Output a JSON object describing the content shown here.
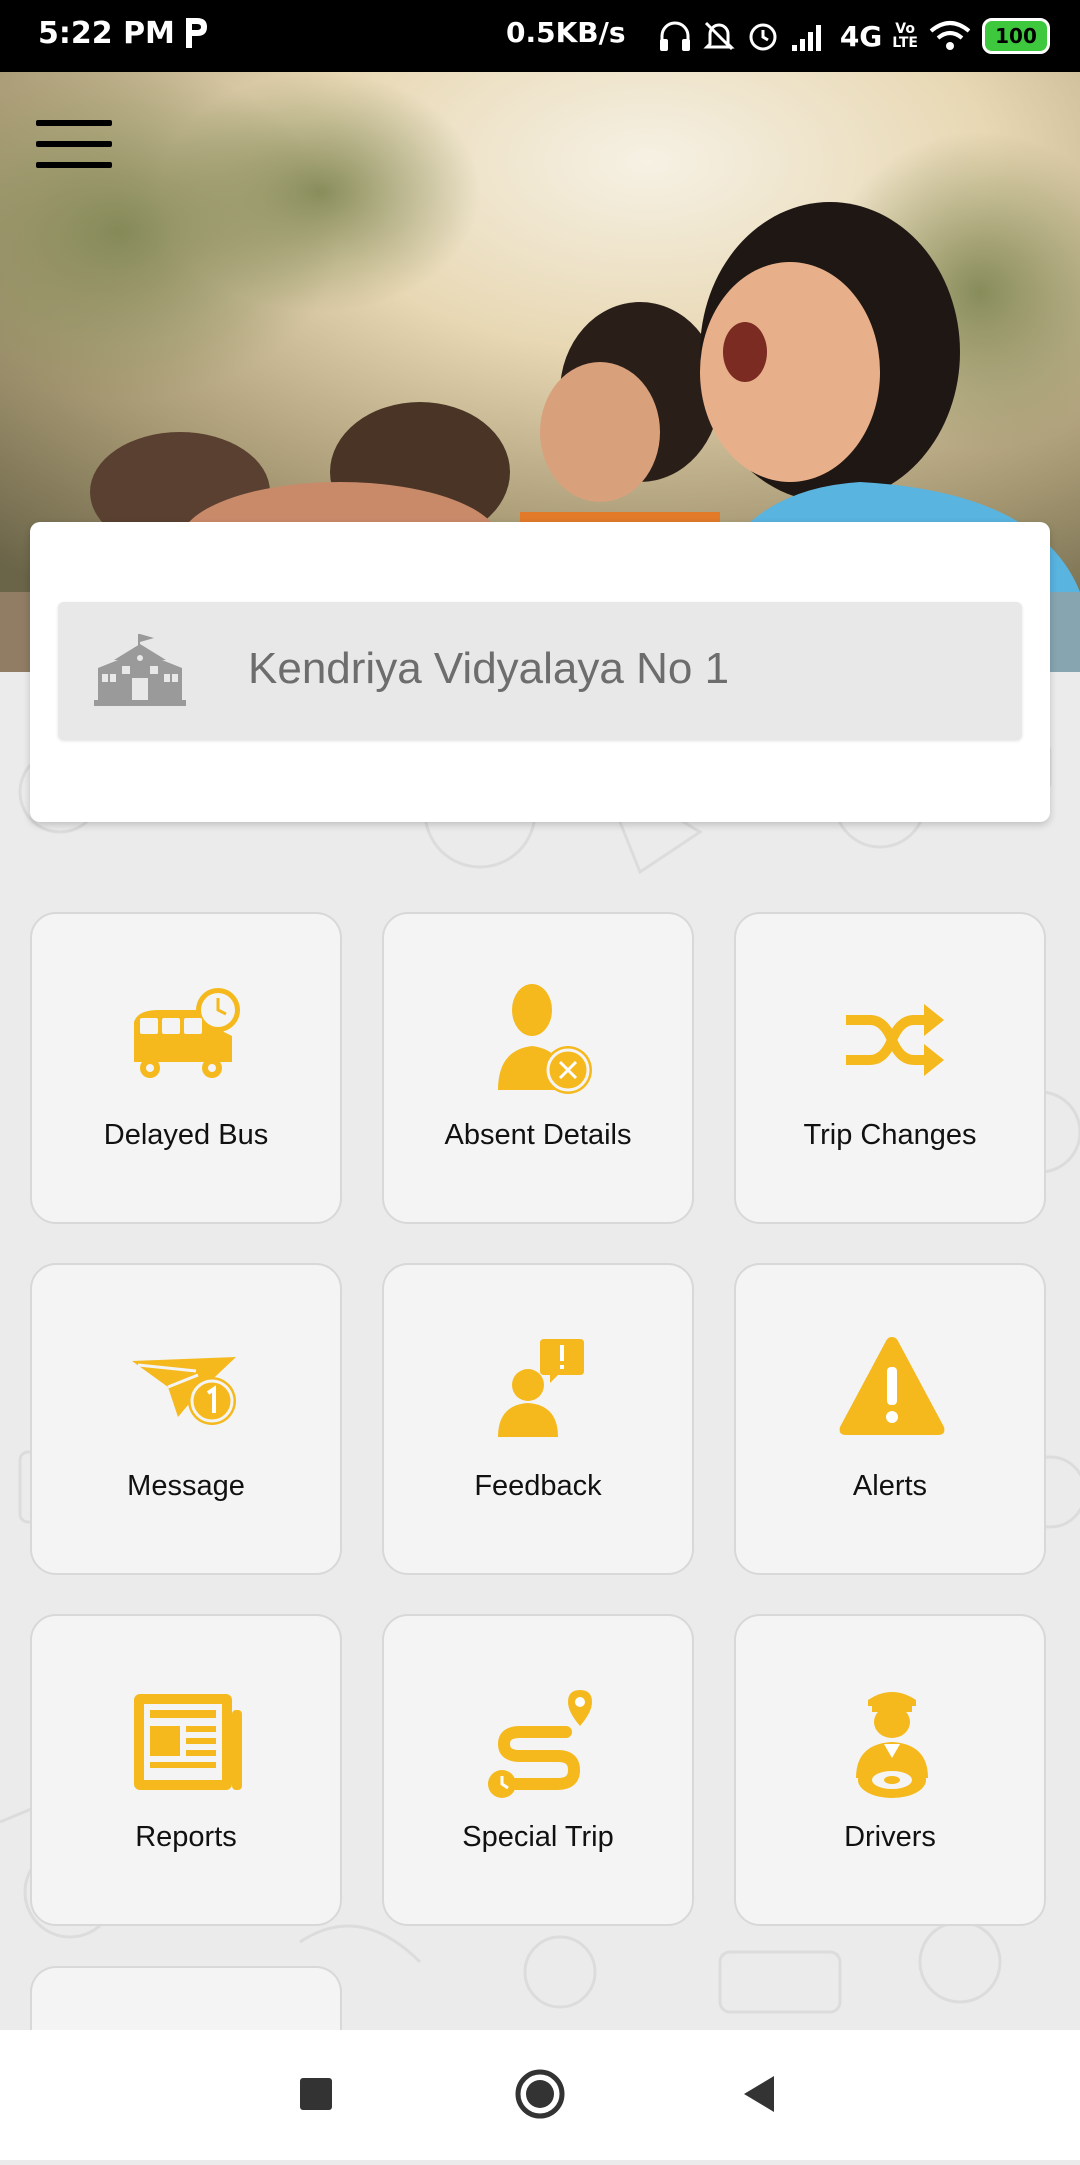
{
  "status_bar": {
    "time": "5:22 PM",
    "data_rate": "0.5KB/s",
    "network": "4G",
    "volte_top": "Vo",
    "volte_bottom": "LTE",
    "battery": "100"
  },
  "header": {
    "school_name": "Kendriya Vidyalaya No 1"
  },
  "tiles": [
    {
      "label": "Delayed Bus",
      "icon": "bus-clock-icon"
    },
    {
      "label": "Absent Details",
      "icon": "person-cross-icon"
    },
    {
      "label": "Trip Changes",
      "icon": "shuffle-icon"
    },
    {
      "label": "Message",
      "icon": "paper-plane-badge-icon"
    },
    {
      "label": "Feedback",
      "icon": "person-exclamation-icon"
    },
    {
      "label": "Alerts",
      "icon": "warning-triangle-icon"
    },
    {
      "label": "Reports",
      "icon": "newspaper-icon"
    },
    {
      "label": "Special Trip",
      "icon": "route-icon"
    },
    {
      "label": "Drivers",
      "icon": "driver-icon"
    }
  ],
  "colors": {
    "accent": "#f5b91e",
    "tile_bg": "#f4f4f4",
    "page_bg": "#ebebeb"
  }
}
